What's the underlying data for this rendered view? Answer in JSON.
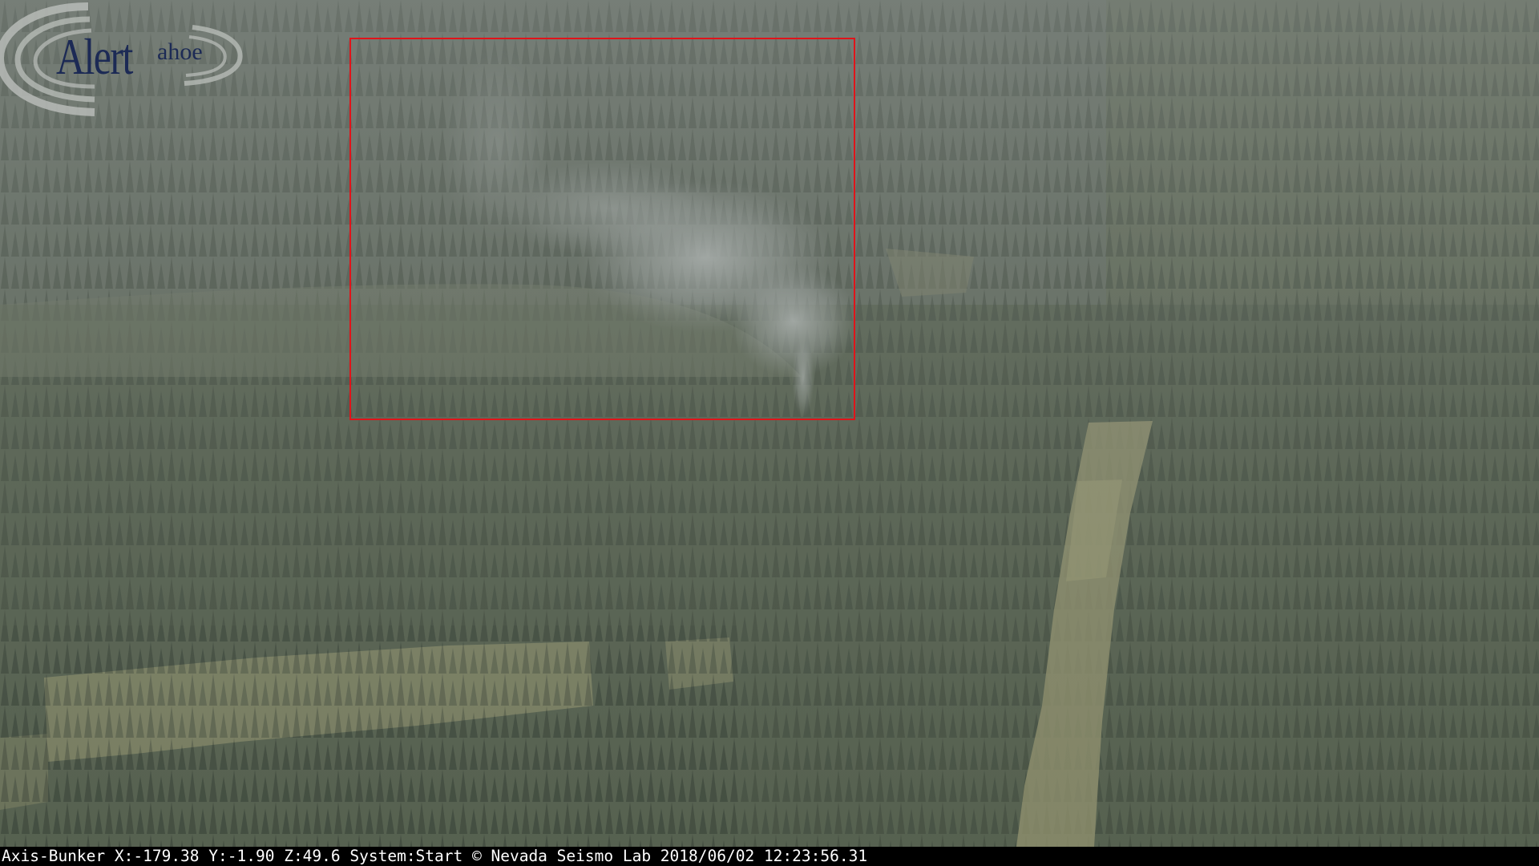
{
  "camera_view": {
    "logo": {
      "word_alert": "Alert",
      "word_tahoe": "ahoe"
    },
    "detection_box": {
      "color": "#e0141a"
    },
    "status_bar": {
      "text": "Axis-Bunker X:-179.38 Y:-1.90 Z:49.6 System:Start © Nevada Seismo Lab 2018/06/02 12:23:56.31"
    }
  }
}
